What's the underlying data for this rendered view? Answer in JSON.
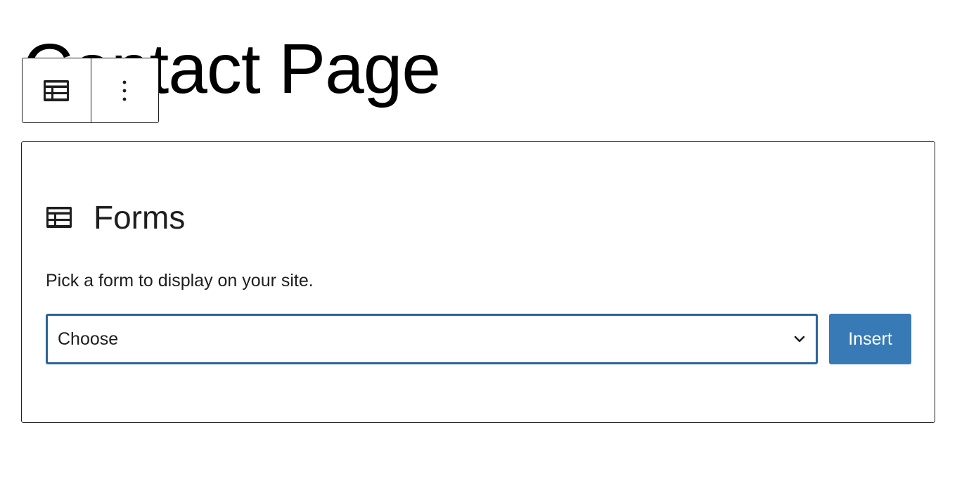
{
  "page": {
    "title": "Contact Page"
  },
  "toolbar": {
    "block_icon": "form-block-icon",
    "more_icon": "vertical-ellipsis-icon"
  },
  "block": {
    "icon": "form-block-icon",
    "title": "Forms",
    "instructions": "Pick a form to display on your site.",
    "select": {
      "value": "Choose",
      "icon": "chevron-down-icon"
    },
    "insert_label": "Insert"
  },
  "colors": {
    "accent": "#387ab5",
    "focus_border": "#2a6494",
    "text": "#1e1e1e"
  }
}
